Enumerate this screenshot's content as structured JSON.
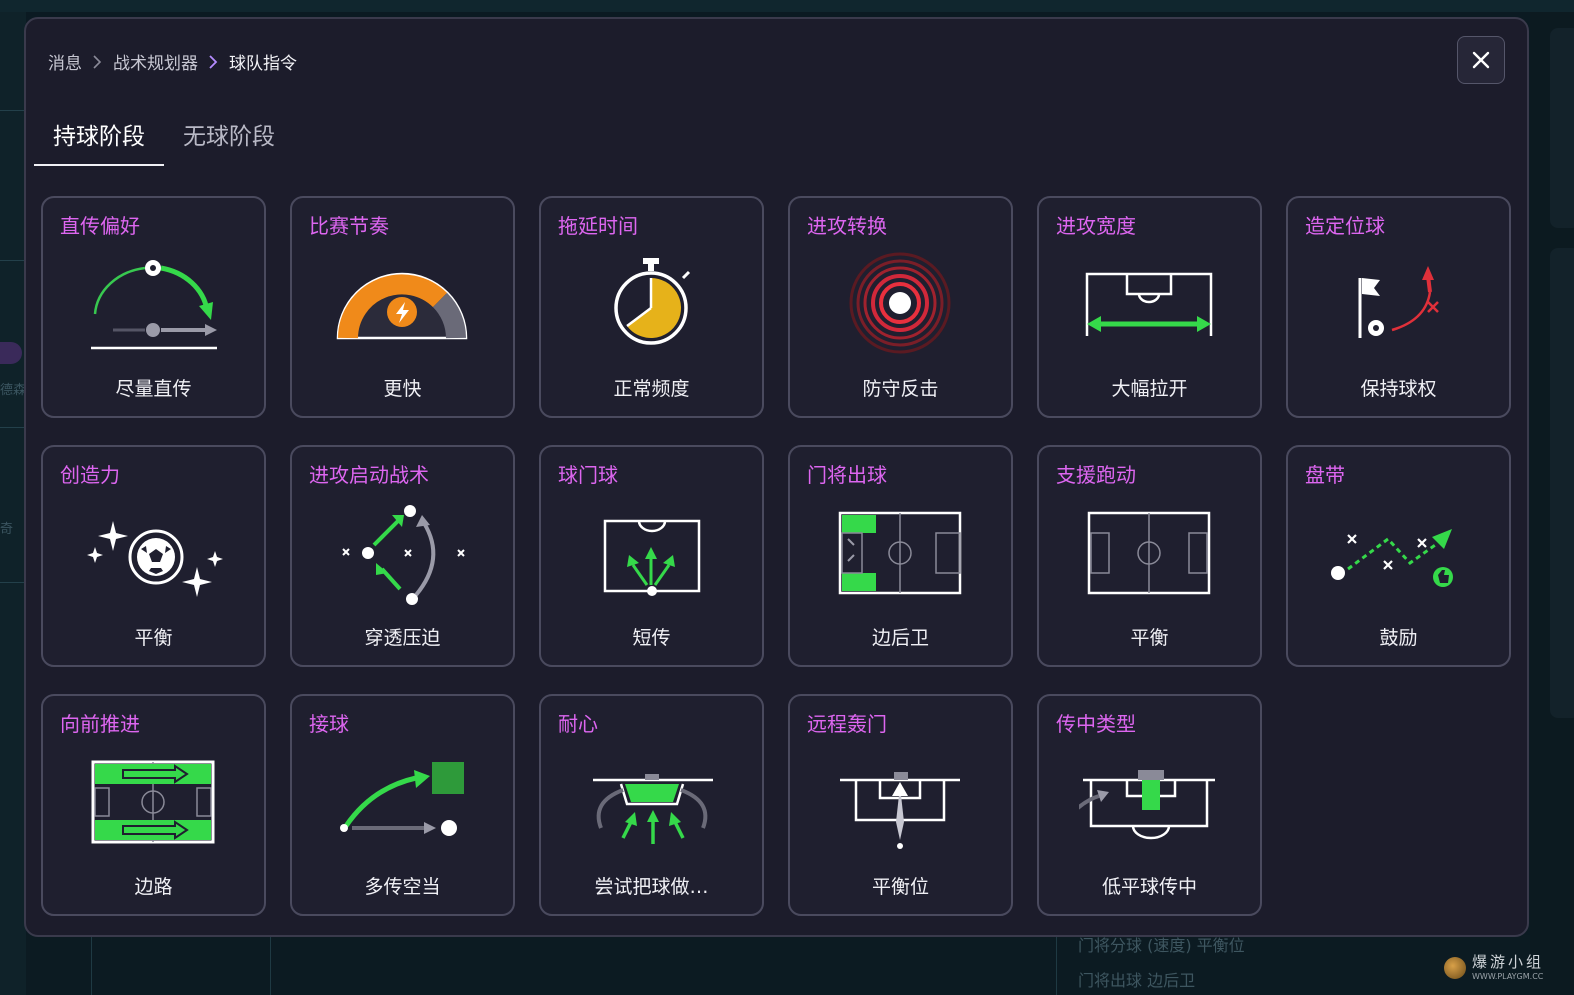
{
  "breadcrumb": {
    "items": [
      "消息",
      "战术规划器",
      "球队指令"
    ]
  },
  "tabs": [
    {
      "label": "持球阶段",
      "active": true
    },
    {
      "label": "无球阶段",
      "active": false
    }
  ],
  "cards": [
    {
      "title": "直传偏好",
      "value": "尽量直传",
      "icon": "through-pass-icon"
    },
    {
      "title": "比赛节奏",
      "value": "更快",
      "icon": "tempo-gauge-icon"
    },
    {
      "title": "拖延时间",
      "value": "正常频度",
      "icon": "stopwatch-icon"
    },
    {
      "title": "进攻转换",
      "value": "防守反击",
      "icon": "counter-target-icon"
    },
    {
      "title": "进攻宽度",
      "value": "大幅拉开",
      "icon": "pitch-width-icon"
    },
    {
      "title": "造定位球",
      "value": "保持球权",
      "icon": "corner-flag-icon"
    },
    {
      "title": "创造力",
      "value": "平衡",
      "icon": "sparkle-ball-icon"
    },
    {
      "title": "进攻启动战术",
      "value": "穿透压迫",
      "icon": "press-break-icon"
    },
    {
      "title": "球门球",
      "value": "短传",
      "icon": "goal-kick-icon"
    },
    {
      "title": "门将出球",
      "value": "边后卫",
      "icon": "gk-distribution-icon"
    },
    {
      "title": "支援跑动",
      "value": "平衡",
      "icon": "support-runs-icon"
    },
    {
      "title": "盘带",
      "value": "鼓励",
      "icon": "dribble-icon"
    },
    {
      "title": "向前推进",
      "value": "边路",
      "icon": "progress-flanks-icon"
    },
    {
      "title": "接球",
      "value": "多传空当",
      "icon": "pass-into-space-icon"
    },
    {
      "title": "耐心",
      "value": "尝试把球做…",
      "icon": "patience-box-icon"
    },
    {
      "title": "远程轰门",
      "value": "平衡位",
      "icon": "long-shot-icon"
    },
    {
      "title": "传中类型",
      "value": "低平球传中",
      "icon": "low-cross-icon"
    }
  ],
  "background": {
    "left_fragments": [
      "德森",
      "奇"
    ],
    "bottom_rows": [
      "门将分球 (速度) 平衡位",
      "门将出球 边后卫"
    ]
  },
  "watermark": {
    "main": "爆游小组",
    "sub": "WWW.PLAYGM.CC"
  },
  "colors": {
    "accent_title": "#dd66f0",
    "green": "#35d94a",
    "red": "#e0303a",
    "orange": "#f08a1a"
  }
}
